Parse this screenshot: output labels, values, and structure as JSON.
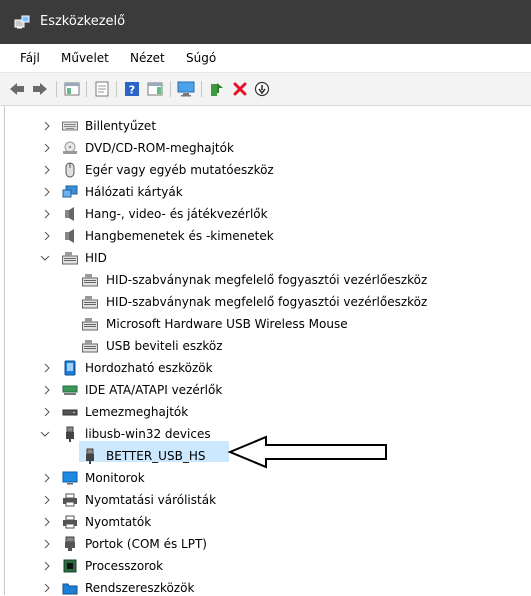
{
  "window": {
    "title": "Eszközkezelő"
  },
  "menu": {
    "items": [
      {
        "label": "Fájl"
      },
      {
        "label": "Művelet"
      },
      {
        "label": "Nézet"
      },
      {
        "label": "Súgó"
      }
    ]
  },
  "toolbar": {
    "buttons": [
      {
        "icon": "back-arrow-icon"
      },
      {
        "icon": "forward-arrow-icon"
      },
      {
        "icon": "show-hide-console-tree-icon"
      },
      {
        "icon": "properties-icon"
      },
      {
        "icon": "help-icon"
      },
      {
        "icon": "action-pane-icon"
      },
      {
        "icon": "scan-hardware-icon"
      },
      {
        "icon": "update-driver-icon"
      },
      {
        "icon": "uninstall-device-icon"
      },
      {
        "icon": "disable-device-icon"
      }
    ]
  },
  "tree": {
    "categories": [
      {
        "label": "Billentyűzet"
      },
      {
        "label": "DVD/CD-ROM-meghajtók"
      },
      {
        "label": "Egér vagy egyéb mutatóeszköz"
      },
      {
        "label": "Hálózati kártyák"
      },
      {
        "label": "Hang-, video- és játékvezérlők"
      },
      {
        "label": "Hangbemenetek és -kimenetek"
      },
      {
        "label": "HID"
      },
      {
        "label": "Hordozható eszközök"
      },
      {
        "label": "IDE ATA/ATAPI vezérlők"
      },
      {
        "label": "Lemezmeghajtók"
      },
      {
        "label": "libusb-win32 devices"
      },
      {
        "label": "Monitorok"
      },
      {
        "label": "Nyomtatási várólisták"
      },
      {
        "label": "Nyomtatók"
      },
      {
        "label": "Portok (COM és LPT)"
      },
      {
        "label": "Processzorok"
      },
      {
        "label": "Rendszereszközök"
      }
    ],
    "hid_children": [
      {
        "label": "HID-szabványnak megfelelő fogyasztói vezérlőeszköz"
      },
      {
        "label": "HID-szabványnak megfelelő fogyasztói vezérlőeszköz"
      },
      {
        "label": "Microsoft Hardware USB Wireless Mouse"
      },
      {
        "label": "USB beviteli eszköz"
      }
    ],
    "libusb_children": [
      {
        "label": "BETTER_USB_HS"
      }
    ]
  },
  "colors": {
    "titlebar": "#3b3b3b",
    "selection": "#cce8ff",
    "delete_red": "#e81123",
    "folder_blue": "#1e7fd6"
  }
}
